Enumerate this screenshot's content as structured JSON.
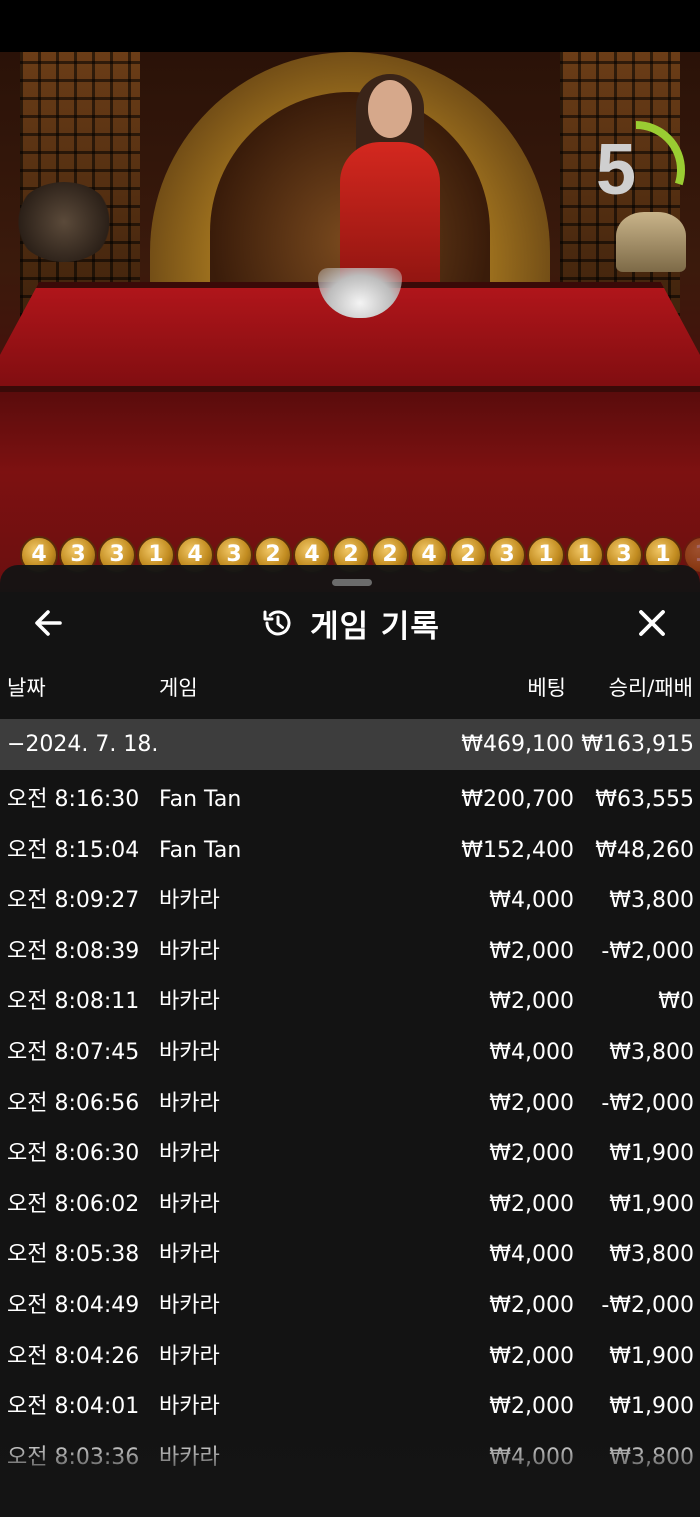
{
  "video": {
    "timer": "5",
    "timer_progress": 0.3,
    "road": [
      "4",
      "3",
      "3",
      "1",
      "4",
      "3",
      "2",
      "4",
      "2",
      "2",
      "4",
      "2",
      "3",
      "1",
      "1",
      "3",
      "1",
      "1"
    ]
  },
  "sheet": {
    "title": "게임 기록",
    "icons": {
      "back": "arrow-left-icon",
      "history": "history-icon",
      "close": "close-icon"
    },
    "columns": {
      "date": "날짜",
      "game": "게임",
      "bet": "베팅",
      "result": "승리/패배"
    },
    "summary": {
      "date": "−2024. 7. 18.",
      "bet": "₩469,100",
      "result": "₩163,915"
    },
    "rows": [
      {
        "time": "오전 8:16:30",
        "game": "Fan Tan",
        "bet": "₩200,700",
        "result": "₩63,555"
      },
      {
        "time": "오전 8:15:04",
        "game": "Fan Tan",
        "bet": "₩152,400",
        "result": "₩48,260"
      },
      {
        "time": "오전 8:09:27",
        "game": "바카라",
        "bet": "₩4,000",
        "result": "₩3,800"
      },
      {
        "time": "오전 8:08:39",
        "game": "바카라",
        "bet": "₩2,000",
        "result": "-₩2,000"
      },
      {
        "time": "오전 8:08:11",
        "game": "바카라",
        "bet": "₩2,000",
        "result": "₩0"
      },
      {
        "time": "오전 8:07:45",
        "game": "바카라",
        "bet": "₩4,000",
        "result": "₩3,800"
      },
      {
        "time": "오전 8:06:56",
        "game": "바카라",
        "bet": "₩2,000",
        "result": "-₩2,000"
      },
      {
        "time": "오전 8:06:30",
        "game": "바카라",
        "bet": "₩2,000",
        "result": "₩1,900"
      },
      {
        "time": "오전 8:06:02",
        "game": "바카라",
        "bet": "₩2,000",
        "result": "₩1,900"
      },
      {
        "time": "오전 8:05:38",
        "game": "바카라",
        "bet": "₩4,000",
        "result": "₩3,800"
      },
      {
        "time": "오전 8:04:49",
        "game": "바카라",
        "bet": "₩2,000",
        "result": "-₩2,000"
      },
      {
        "time": "오전 8:04:26",
        "game": "바카라",
        "bet": "₩2,000",
        "result": "₩1,900"
      },
      {
        "time": "오전 8:04:01",
        "game": "바카라",
        "bet": "₩2,000",
        "result": "₩1,900"
      },
      {
        "time": "오전 8:03:36",
        "game": "바카라",
        "bet": "₩4,000",
        "result": "₩3,800"
      }
    ]
  }
}
